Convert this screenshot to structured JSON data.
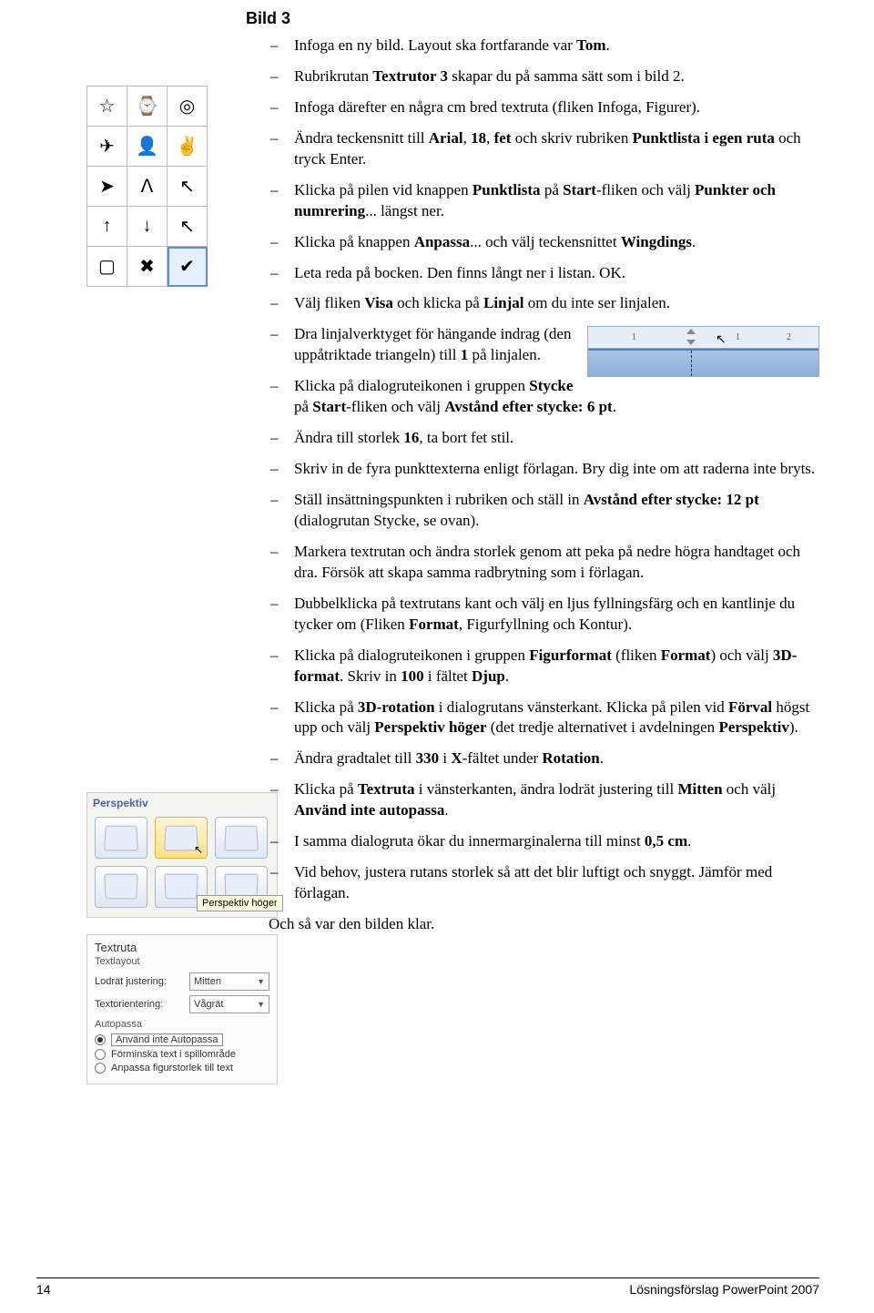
{
  "heading": "Bild 3",
  "items": [
    "Infoga en ny bild. Layout ska fortfarande var <b>Tom</b>.",
    "Rubrikrutan <b>Textrutor 3</b> skapar du på samma sätt som i bild 2.",
    "Infoga därefter en några cm bred textruta (fliken Infoga, Figurer).",
    "Ändra teckensnitt till <b>Arial</b>, <b>18</b>, <b>fet</b> och skriv rubriken <b>Punktlista i egen ruta</b> och tryck Enter.",
    "Klicka på pilen vid knappen <b>Punktlista</b> på <b>Start</b>-fliken och välj <b>Punkter och numrering</b>... längst ner.",
    "Klicka på knappen <b>Anpassa</b>... och välj teckensnittet <b>Wingdings</b>.",
    "Leta reda på bocken. Den finns långt ner i listan. OK.",
    "Välj fliken <b>Visa</b> och klicka på <b>Linjal</b> om du inte ser linjalen.",
    "Dra linjalverktyget för hängande indrag (den uppåtriktade triangeln) till <b>1</b> på linjalen.",
    "Klicka på dialogruteikonen i gruppen <b>Stycke</b> på <b>Start</b>-fliken och välj <b>Avstånd efter stycke: 6 pt</b>.",
    "Ändra till storlek <b>16</b>, ta bort fet stil.",
    "Skriv in de fyra punkttexterna enligt förlagan. Bry dig inte om att raderna inte bryts.",
    "Ställ insättningspunkten i rubriken och ställ in <b>Avstånd efter stycke: 12 pt</b> (dialogrutan Stycke, se ovan).",
    "Markera textrutan och ändra storlek genom att peka på nedre högra handtaget och dra. Försök att skapa samma radbrytning som i förlagan.",
    "Dubbelklicka på textrutans kant och välj en ljus fyllningsfärg och en kantlinje du tycker om (Fliken <b>Format</b>, Figurfyllning och Kontur).",
    "Klicka på dialogruteikonen i gruppen <b>Figurformat</b> (fliken <b>Format</b>) och välj <b>3D-format</b>. Skriv in <b>100</b> i fältet <b>Djup</b>.",
    "Klicka på <b>3D-rotation</b> i dialogrutans vänsterkant. Klicka på pilen vid <b>Förval</b> högst upp och välj <b>Perspektiv höger</b> (det tredje alternativet i avdelningen <b>Perspektiv</b>).",
    "Ändra gradtalet till <b>330</b> i <b>X</b>-fältet under <b>Rotation</b>.",
    "Klicka på <b>Textruta</b> i vänsterkanten, ändra lodrät justering till <b>Mitten</b> och välj <b>Använd inte autopassa</b>.",
    "I samma dialogruta ökar du innermarginalerna till minst <b>0,5 cm</b>.",
    "Vid behov, justera rutans storlek så att det blir luftigt och snyggt. Jämför med förlagan."
  ],
  "closing": "Och så var den bilden klar.",
  "bulletGrid": [
    [
      "☆",
      "⌚",
      "◎"
    ],
    [
      "✈",
      "👤",
      "✌"
    ],
    [
      "➤",
      "ᐱ",
      "↖"
    ],
    [
      "↑",
      "↓",
      "↖"
    ],
    [
      "▢",
      "✖",
      "✔"
    ]
  ],
  "ruler": {
    "n1": "1",
    "n1b": "1",
    "n2": "2"
  },
  "perspective": {
    "label": "Perspektiv",
    "tooltip": "Perspektiv höger"
  },
  "textruta": {
    "title": "Textruta",
    "subtitle": "Textlayout",
    "vertLabel": "Lodrät justering:",
    "vertValue": "Mitten",
    "orientLabel": "Textorientering:",
    "orientValue": "Vågrät",
    "autoTitle": "Autopassa",
    "r1": "Använd inte Autopassa",
    "r2": "Förminska text i spillområde",
    "r3": "Anpassa figurstorlek till text"
  },
  "footer": {
    "page": "14",
    "title": "Lösningsförslag PowerPoint 2007"
  }
}
